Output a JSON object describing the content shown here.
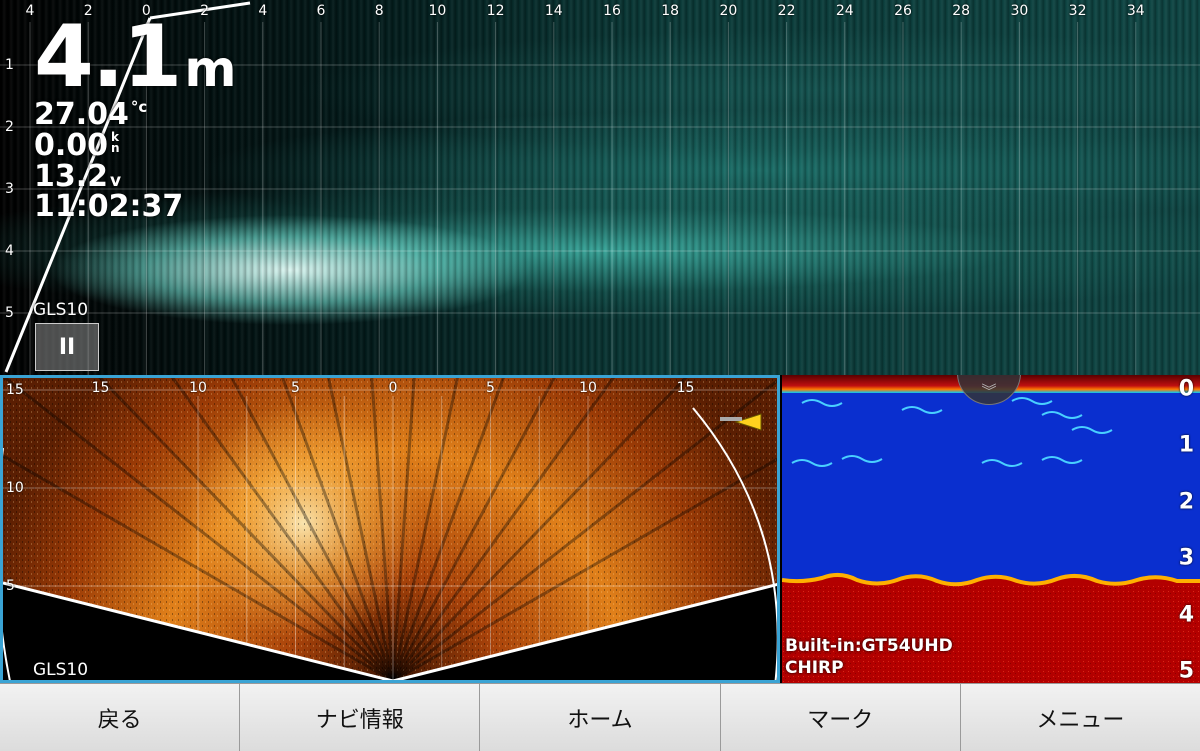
{
  "top_panel": {
    "x_ticks": [
      "4",
      "2",
      "0",
      "2",
      "4",
      "6",
      "8",
      "10",
      "12",
      "14",
      "16",
      "18",
      "20",
      "22",
      "24",
      "26",
      "28",
      "30",
      "32",
      "34"
    ],
    "y_ticks": [
      "1",
      "2",
      "3",
      "4",
      "5"
    ],
    "depth": {
      "value": "4.1",
      "unit": "m"
    },
    "water_temp": {
      "value": "27.04",
      "unit": "°c"
    },
    "speed": {
      "value": "0.00",
      "unit_top": "k",
      "unit_bottom": "n"
    },
    "voltage": {
      "value": "13.2",
      "unit": "v"
    },
    "time": "11:02:37",
    "source": "GLS10",
    "pause_label": "II"
  },
  "fan_panel": {
    "x_ticks": [
      "15",
      "10",
      "5",
      "0",
      "5",
      "10",
      "15"
    ],
    "y_ticks": [
      "15",
      "10",
      "5"
    ],
    "source": "GLS10"
  },
  "echo_panel": {
    "depth_ticks": [
      "0",
      "1",
      "2",
      "3",
      "4",
      "5"
    ],
    "transducer": "Built-in:GT54UHD",
    "mode": "CHIRP",
    "collapse_icon": "chevron-double-down-icon"
  },
  "nav": {
    "back": "戻る",
    "navi_info": "ナビ情報",
    "home": "ホーム",
    "mark": "マーク",
    "menu": "メニュー"
  },
  "colors": {
    "panel_border": "#3aa3d4",
    "echo_background": "#0a2fcf",
    "echo_bottom": "#b30000",
    "top_sonar": "#4fd6c4",
    "fan_sonar": "#e07a10"
  }
}
